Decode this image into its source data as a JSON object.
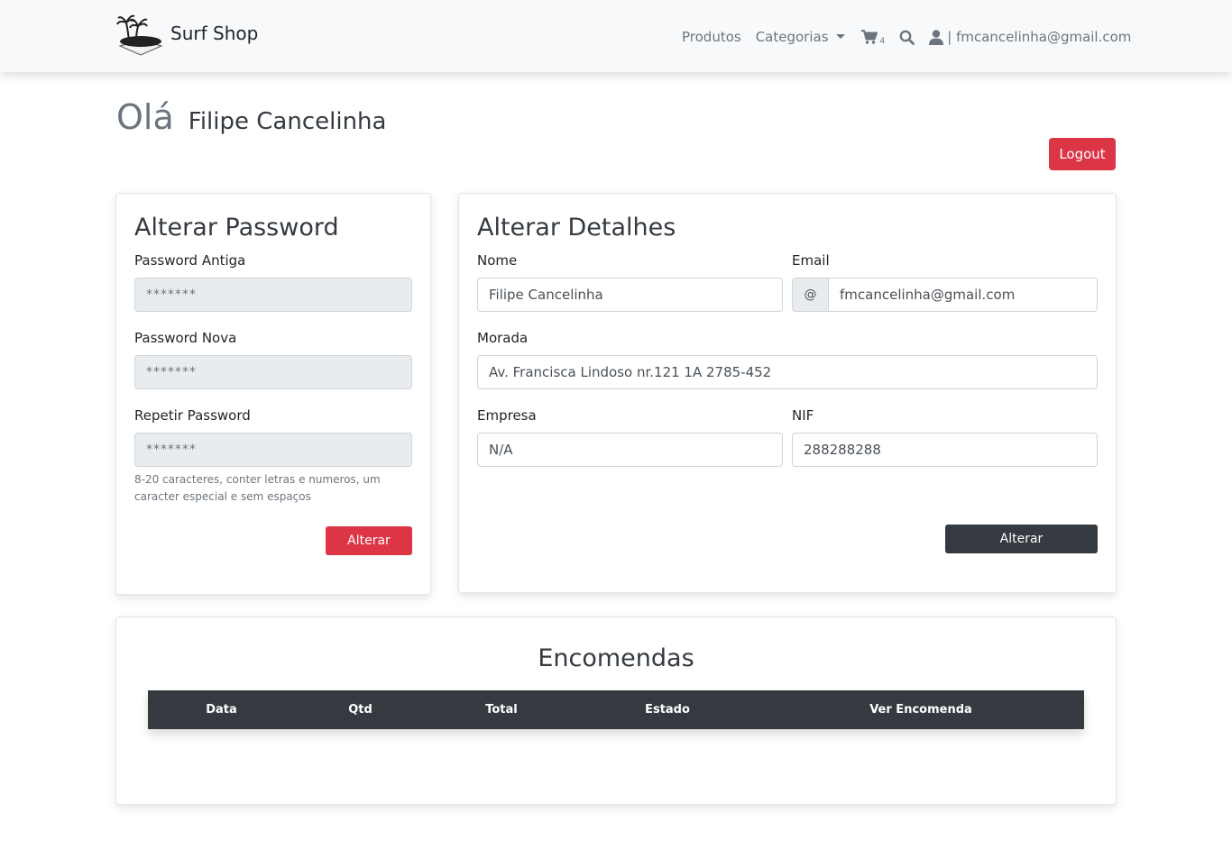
{
  "navbar": {
    "brand": "Surf Shop",
    "links": {
      "products": "Produtos",
      "categories": "Categorias"
    },
    "cart_count": "4",
    "user_email": "| fmcancelinha@gmail.com"
  },
  "greeting": {
    "hello": "Olá",
    "name": "Filipe Cancelinha"
  },
  "logout_label": "Logout",
  "password_form": {
    "title": "Alterar Password",
    "old_label": "Password Antiga",
    "old_placeholder": "*******",
    "new_label": "Password Nova",
    "new_placeholder": "*******",
    "repeat_label": "Repetir Password",
    "repeat_placeholder": "*******",
    "hint": "8-20 caracteres, conter letras e numeros, um caracter especial e sem espaços",
    "submit": "Alterar"
  },
  "details_form": {
    "title": "Alterar Detalhes",
    "name_label": "Nome",
    "name_value": "Filipe Cancelinha",
    "email_label": "Email",
    "email_addon": "@",
    "email_value": "fmcancelinha@gmail.com",
    "address_label": "Morada",
    "address_value": "Av. Francisca Lindoso nr.121 1A 2785-452",
    "company_label": "Empresa",
    "company_value": "N/A",
    "nif_label": "NIF",
    "nif_value": "288288288",
    "submit": "Alterar"
  },
  "orders": {
    "title": "Encomendas",
    "columns": [
      "Data",
      "Qtd",
      "Total",
      "Estado",
      "Ver Encomenda"
    ]
  },
  "colors": {
    "danger": "#dc3545",
    "dark": "#343a40",
    "navbar_bg": "#f8f9fa"
  },
  "icons": [
    "island-logo",
    "cart-icon",
    "search-icon",
    "user-icon",
    "chevron-down-icon"
  ]
}
